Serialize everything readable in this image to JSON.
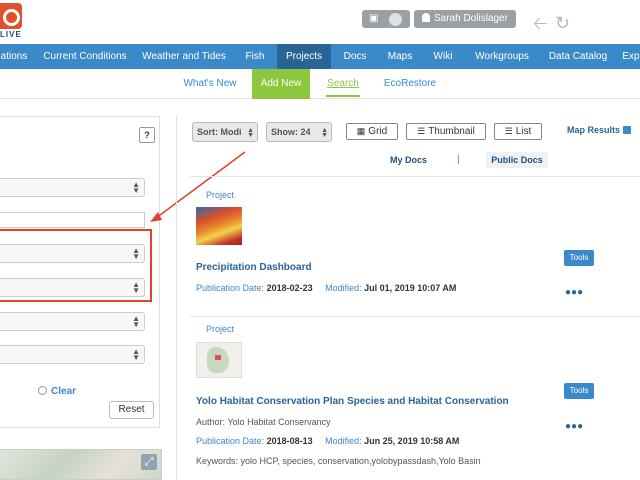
{
  "header": {
    "logo_text": "LIVE",
    "user_name": "Sarah Dolislager"
  },
  "nav": {
    "items": [
      "ations",
      "Current Conditions",
      "Weather and Tides",
      "Fish",
      "Projects",
      "Docs",
      "Maps",
      "Wiki",
      "Workgroups",
      "Data Catalog",
      "Exp"
    ],
    "active": "Projects"
  },
  "subnav": {
    "items": [
      "What's New",
      "Add New",
      "Search",
      "EcoRestore"
    ]
  },
  "left": {
    "help_label": "?",
    "clear_label": "Clear",
    "reset_label": "Reset"
  },
  "toolbar": {
    "sort_label": "Sort: Modi",
    "show_label": "Show: 24",
    "grid_label": "Grid",
    "thumbnail_label": "Thumbnail",
    "list_label": "List",
    "map_results_label": "Map Results"
  },
  "doc_tabs": {
    "my_docs": "My Docs",
    "separator": "|",
    "public_docs": "Public Docs"
  },
  "results": [
    {
      "tag": "Project",
      "title": "Precipitation Dashboard",
      "pub_label": "Publication Date:",
      "pub_date": "2018-02-23",
      "mod_label": "Modified:",
      "modified": "Jul 01, 2019 10:07 AM",
      "tools_label": "Tools"
    },
    {
      "tag": "Project",
      "title": "Yolo Habitat Conservation Plan Species and Habitat Conservation",
      "author_label": "Author:",
      "author": "Yolo Habitat Conservancy",
      "pub_label": "Publication Date:",
      "pub_date": "2018-08-13",
      "mod_label": "Modified:",
      "modified": "Jun 25, 2019 10:58 AM",
      "keywords_label": "Keywords:",
      "keywords": "yolo HCP, species, conservation,yolobypassdash,Yolo Basin",
      "tools_label": "Tools"
    }
  ],
  "colors": {
    "nav_blue": "#3a89c9",
    "nav_active": "#2a6496",
    "add_new_green": "#8dc63f",
    "highlight_red": "#e0432b",
    "logo_orange": "#e0502a"
  }
}
